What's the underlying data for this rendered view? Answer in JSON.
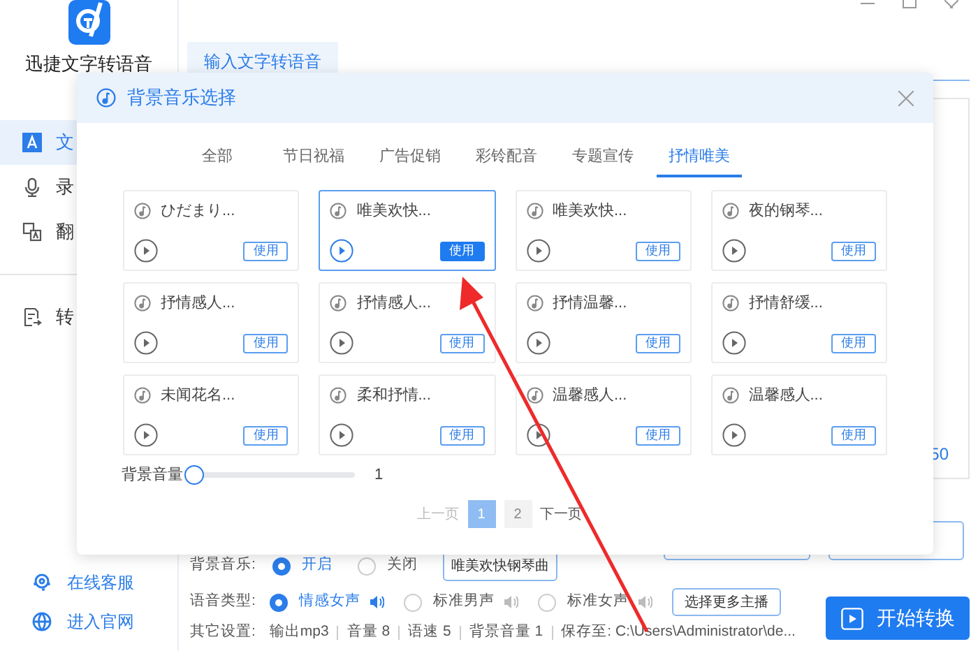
{
  "app": {
    "name": "迅捷文字转语音"
  },
  "sidebar": {
    "items": [
      {
        "label": "文",
        "selected": true
      },
      {
        "label": "录",
        "selected": false
      },
      {
        "label": "翻",
        "selected": false
      },
      {
        "label": "转",
        "selected": false
      }
    ],
    "links": [
      {
        "label": "在线客服"
      },
      {
        "label": "进入官网"
      }
    ]
  },
  "main": {
    "tab": "输入文字转语音",
    "char_count": "50",
    "background_music": {
      "label": "背景音乐:",
      "options": [
        {
          "label": "开启",
          "selected": true
        },
        {
          "label": "关闭",
          "selected": false
        }
      ],
      "track_button": "唯美欢快钢琴曲"
    },
    "voice_type": {
      "label": "语音类型:",
      "options": [
        {
          "label": "情感女声",
          "selected": true
        },
        {
          "label": "标准男声",
          "selected": false
        },
        {
          "label": "标准女声",
          "selected": false
        }
      ],
      "more_button": "选择更多主播"
    },
    "other_settings": {
      "label": "其它设置:",
      "items": [
        "输出mp3",
        "音量 8",
        "语速 5",
        "背景音量 1",
        "保存至: C:\\Users\\Administrator\\de..."
      ]
    },
    "start_button": "开始转换"
  },
  "dialog": {
    "title": "背景音乐选择",
    "tabs": [
      {
        "label": "全部",
        "selected": false
      },
      {
        "label": "节日祝福",
        "selected": false
      },
      {
        "label": "广告促销",
        "selected": false
      },
      {
        "label": "彩铃配音",
        "selected": false
      },
      {
        "label": "专题宣传",
        "selected": false
      },
      {
        "label": "抒情唯美",
        "selected": true
      }
    ],
    "tracks": [
      {
        "name": "ひだまり...",
        "selected": false,
        "action": "使用"
      },
      {
        "name": "唯美欢快...",
        "selected": true,
        "action": "使用"
      },
      {
        "name": "唯美欢快...",
        "selected": false,
        "action": "使用"
      },
      {
        "name": "夜的钢琴...",
        "selected": false,
        "action": "使用"
      },
      {
        "name": "抒情感人...",
        "selected": false,
        "action": "使用"
      },
      {
        "name": "抒情感人...",
        "selected": false,
        "action": "使用"
      },
      {
        "name": "抒情温馨...",
        "selected": false,
        "action": "使用"
      },
      {
        "name": "抒情舒缓...",
        "selected": false,
        "action": "使用"
      },
      {
        "name": "未闻花名...",
        "selected": false,
        "action": "使用"
      },
      {
        "name": "柔和抒情...",
        "selected": false,
        "action": "使用"
      },
      {
        "name": "温馨感人...",
        "selected": false,
        "action": "使用"
      },
      {
        "name": "温馨感人...",
        "selected": false,
        "action": "使用"
      }
    ],
    "volume": {
      "label": "背景音量",
      "level": 0,
      "reading": "1"
    },
    "pagination": {
      "prev": {
        "label": "上一页",
        "disabled": true
      },
      "pages": [
        {
          "label": "1",
          "selected": true
        },
        {
          "label": "2",
          "selected": false
        }
      ],
      "next": {
        "label": "下一页",
        "disabled": false
      }
    }
  }
}
